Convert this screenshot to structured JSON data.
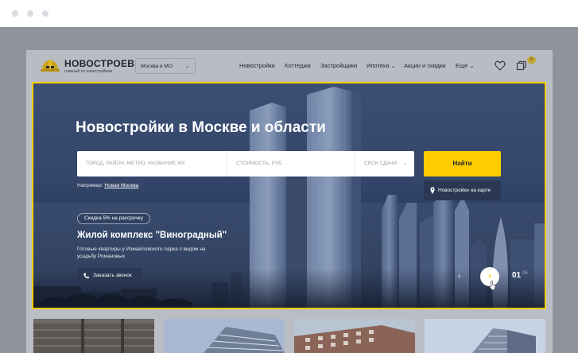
{
  "header": {
    "logo_title": "НОВОСТРОЕВ",
    "logo_tagline": "главный по новостройкам",
    "region": "Москва и МО",
    "nav": [
      {
        "label": "Новостройки",
        "dropdown": false
      },
      {
        "label": "Коттеджи",
        "dropdown": false
      },
      {
        "label": "Застройщики",
        "dropdown": false
      },
      {
        "label": "Ипотека",
        "dropdown": true
      },
      {
        "label": "Акции и скидки",
        "dropdown": false
      },
      {
        "label": "Еще",
        "dropdown": true
      }
    ],
    "compare_count": "0"
  },
  "hero": {
    "title": "Новостройки в Москве и области",
    "search": {
      "location_placeholder": "ГОРОД, РАЙОН, МЕТРО, НАЗВАНИЕ ЖК",
      "price_placeholder": "СТОИМОСТЬ, РУБ.",
      "deadline_placeholder": "СРОК СДАЧИ"
    },
    "find_label": "Найти",
    "map_label": "Новостройки на карте",
    "example_prefix": "Например:",
    "example_link": "Новая Москва",
    "discount": "Скидка 5% на рассрочку",
    "complex_title": "Жилой комплекс \"Виноградный\"",
    "complex_desc": "Готовые квартиры у Измайловского парка с видом на усадьбу Романовых",
    "call_label": "Заказать звонок",
    "slide_current": "01",
    "slide_total": "05"
  },
  "colors": {
    "accent": "#ffcc00",
    "dark_button": "#2b3753"
  },
  "icons": {
    "logo": "helmet-icon",
    "favorites": "heart-icon",
    "compare": "compare-icon",
    "map": "map-pin-icon",
    "call": "phone-icon",
    "prev": "chevron-left-icon",
    "next": "chevron-right-icon"
  }
}
